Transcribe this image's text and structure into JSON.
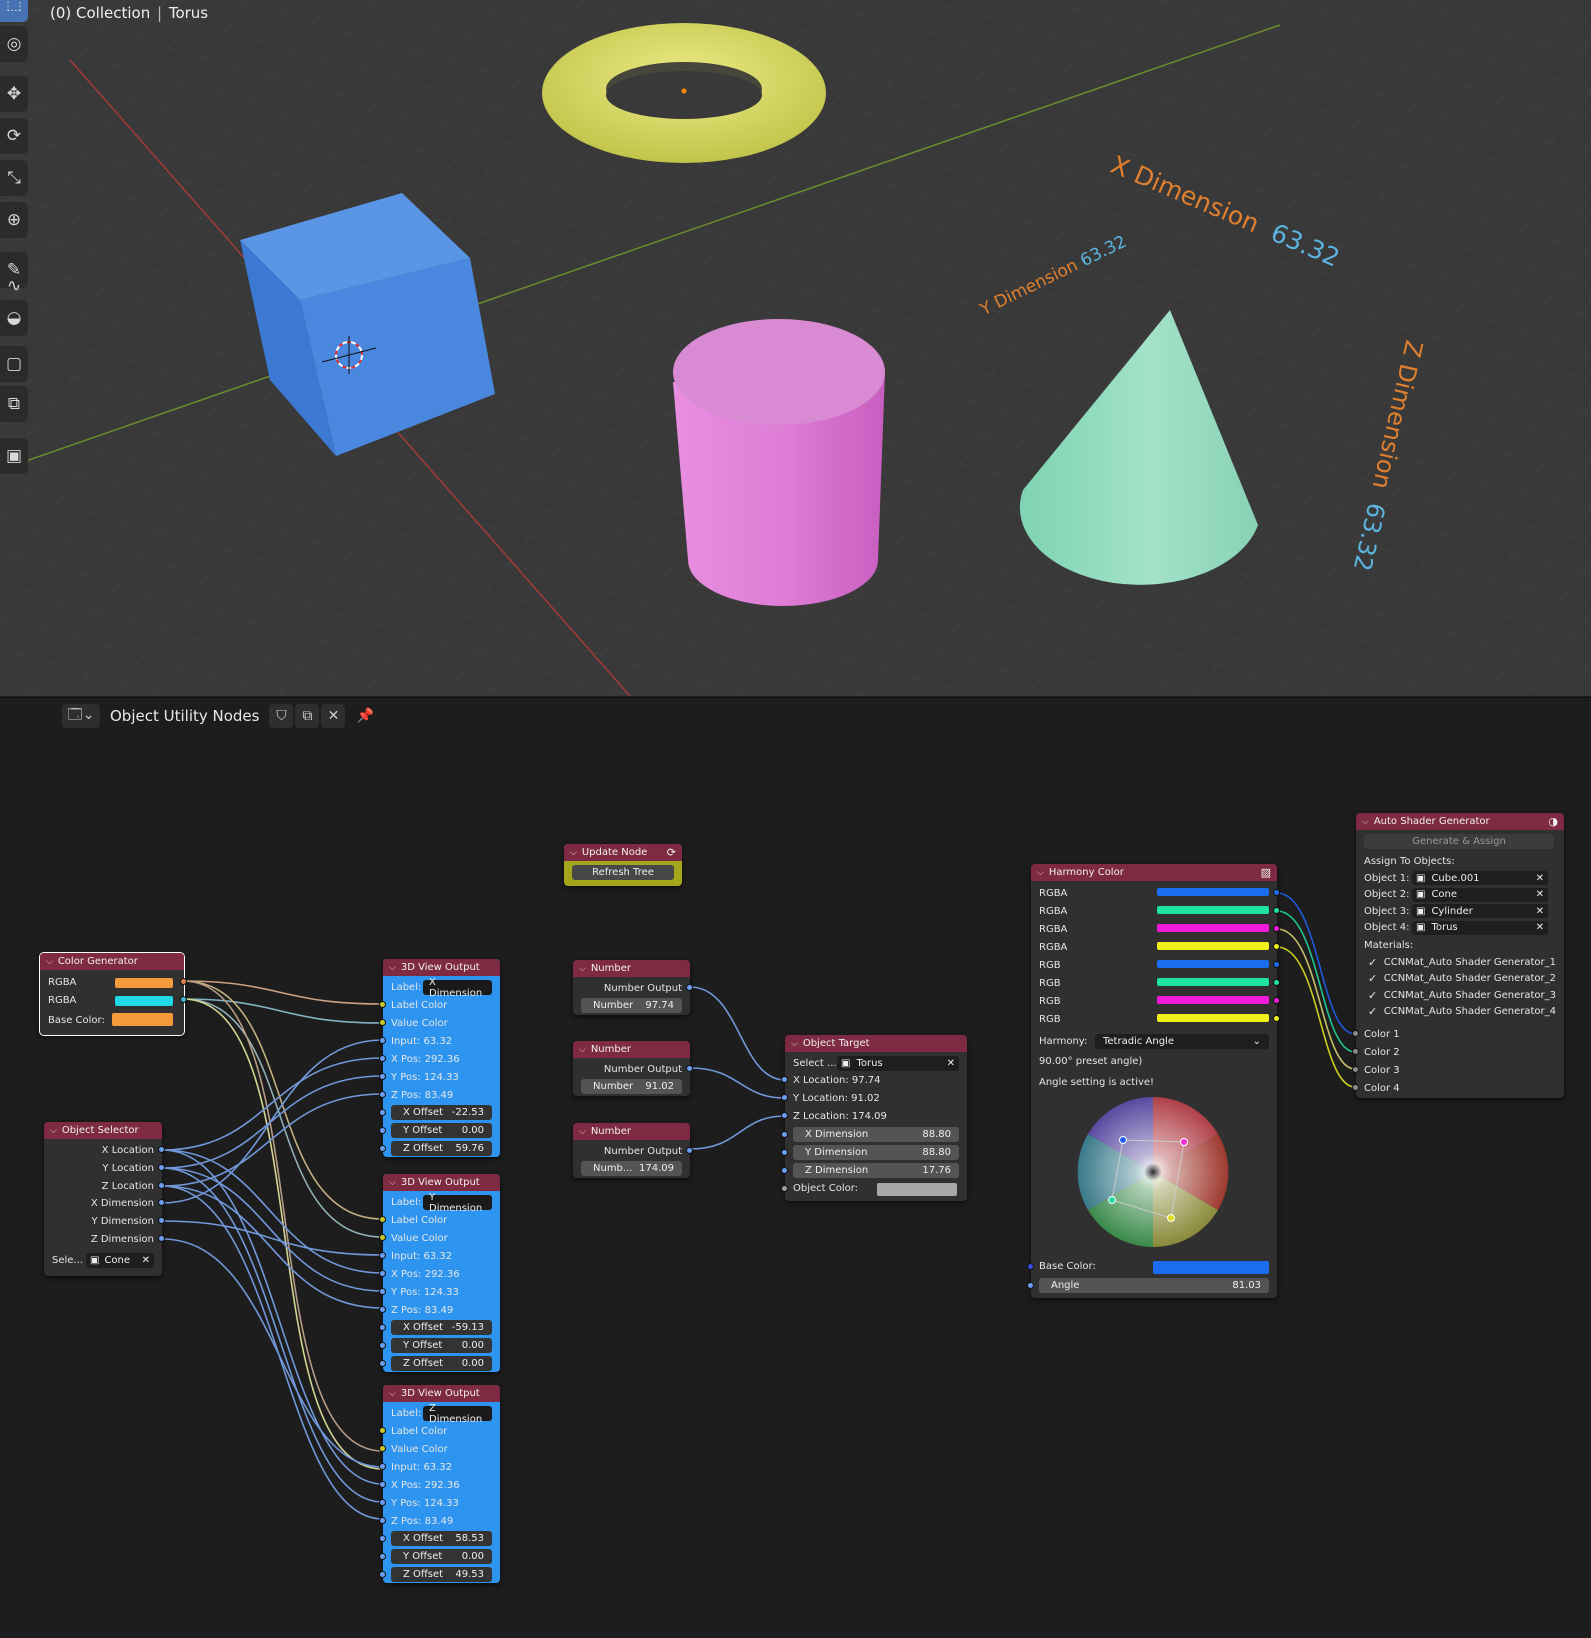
{
  "viewport": {
    "title_left": "(0) Collection",
    "title_separator": "|",
    "title_right": "Torus",
    "tools": [
      "select-box-icon",
      "cursor-icon",
      "move-icon",
      "rotate-icon",
      "scale-icon",
      "transform-icon",
      "annotate-icon",
      "curve-icon",
      "measure-icon",
      "add-cube-icon",
      "extrude-icon",
      "image-icon"
    ],
    "dimension_labels": {
      "x": {
        "label": "X Dimension",
        "value": "63.32"
      },
      "y": {
        "label": "Y Dimension",
        "value": "63.32"
      },
      "z": {
        "label": "Z Dimension",
        "value": "63.32"
      }
    },
    "colors": {
      "cube": "#4f8ae0",
      "torus": "#d7d85a",
      "cylinder": "#de7ad6",
      "cone": "#93dcc0",
      "label_orange": "#e0802f",
      "label_blue": "#5cb5e0"
    }
  },
  "node_editor": {
    "tree_name": "Object Utility Nodes",
    "color_generator": {
      "title": "Color Generator",
      "rows": [
        "RGBA",
        "RGBA",
        "Base Color:"
      ]
    },
    "object_selector": {
      "title": "Object Selector",
      "outputs": [
        "X Location",
        "Y Location",
        "Z Location",
        "X Dimension",
        "Y Dimension",
        "Z Dimension"
      ],
      "select_label": "Sele...",
      "select_value": "Cone"
    },
    "view_outputs": [
      {
        "title": "3D View Output",
        "label_key": "Label:",
        "label_value": "X Dimension",
        "label_color": "Label Color",
        "value_color": "Value Color",
        "input": "Input: 63.32",
        "xpos": "X Pos: 292.36",
        "ypos": "Y Pos: 124.33",
        "zpos": "Z Pos: 83.49",
        "x_offset_label": "X Offset",
        "x_offset": "-22.53",
        "y_offset_label": "Y Offset",
        "y_offset": "0.00",
        "z_offset_label": "Z Offset",
        "z_offset": "59.76"
      },
      {
        "title": "3D View Output",
        "label_key": "Label:",
        "label_value": "Y Dimension",
        "label_color": "Label Color",
        "value_color": "Value Color",
        "input": "Input: 63.32",
        "xpos": "X Pos: 292.36",
        "ypos": "Y Pos: 124.33",
        "zpos": "Z Pos: 83.49",
        "x_offset_label": "X Offset",
        "x_offset": "-59.13",
        "y_offset_label": "Y Offset",
        "y_offset": "0.00",
        "z_offset_label": "Z Offset",
        "z_offset": "0.00"
      },
      {
        "title": "3D View Output",
        "label_key": "Label:",
        "label_value": "Z Dimension",
        "label_color": "Label Color",
        "value_color": "Value Color",
        "input": "Input: 63.32",
        "xpos": "X Pos: 292.36",
        "ypos": "Y Pos: 124.33",
        "zpos": "Z Pos: 83.49",
        "x_offset_label": "X Offset",
        "x_offset": "58.53",
        "y_offset_label": "Y Offset",
        "y_offset": "0.00",
        "z_offset_label": "Z Offset",
        "z_offset": "49.53"
      }
    ],
    "update_node": {
      "title": "Update Node",
      "button": "Refresh Tree"
    },
    "numbers": [
      {
        "title": "Number",
        "output": "Number Output",
        "field_label": "Number",
        "value": "97.74"
      },
      {
        "title": "Number",
        "output": "Number Output",
        "field_label": "Number",
        "value": "91.02"
      },
      {
        "title": "Number",
        "output": "Number Output",
        "field_label": "Numb...",
        "value": "174.09"
      }
    ],
    "object_target": {
      "title": "Object Target",
      "select_label": "Select ...",
      "select_value": "Torus",
      "x_location": "X Location: 97.74",
      "y_location": "Y Location: 91.02",
      "z_location": "Z Location: 174.09",
      "x_dim_label": "X Dimension",
      "x_dim": "88.80",
      "y_dim_label": "Y Dimension",
      "y_dim": "88.80",
      "z_dim_label": "Z Dimension",
      "z_dim": "17.76",
      "object_color": "Object Color:"
    },
    "harmony_color": {
      "title": "Harmony Color",
      "outputs": [
        "RGBA",
        "RGBA",
        "RGBA",
        "RGBA",
        "RGB",
        "RGB",
        "RGB",
        "RGB"
      ],
      "output_colors": [
        "#1a6cf0",
        "#1ee6a0",
        "#f21adb",
        "#f0f01a",
        "#1a6cf0",
        "#1ee6a0",
        "#f21adb",
        "#f0f01a"
      ],
      "harmony_label": "Harmony:",
      "harmony_value": "Tetradic Angle",
      "preset_text": "90.00° preset angle)",
      "active_text": "Angle setting is active!",
      "base_color_label": "Base Color:",
      "base_color": "#1a6cf0",
      "angle_label": "Angle",
      "angle_value": "81.03"
    },
    "auto_shader": {
      "title": "Auto Shader Generator",
      "button": "Generate & Assign",
      "assign_heading": "Assign To Objects:",
      "objects": [
        {
          "label": "Object 1:",
          "value": "Cube.001"
        },
        {
          "label": "Object 2:",
          "value": "Cone"
        },
        {
          "label": "Object 3:",
          "value": "Cylinder"
        },
        {
          "label": "Object 4:",
          "value": "Torus"
        }
      ],
      "materials_heading": "Materials:",
      "materials": [
        "CCNMat_Auto Shader Generator_1",
        "CCNMat_Auto Shader Generator_2",
        "CCNMat_Auto Shader Generator_3",
        "CCNMat_Auto Shader Generator_4"
      ],
      "inputs": [
        "Color 1",
        "Color 2",
        "Color 3",
        "Color 4"
      ]
    }
  }
}
